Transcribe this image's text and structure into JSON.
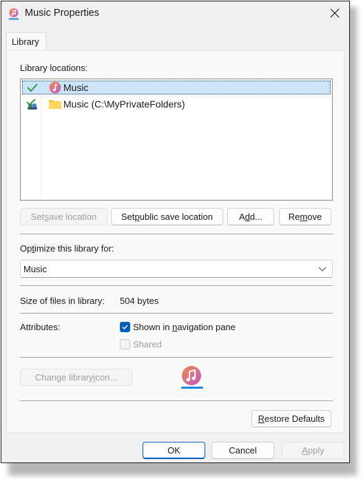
{
  "window": {
    "title": "Music Properties",
    "close_label": "Close"
  },
  "tabs": [
    {
      "label": "Library",
      "active": true
    }
  ],
  "library": {
    "locations_label": "Library locations:",
    "locations": [
      {
        "state_icon": "checkmark-icon",
        "item_icon": "music-library-icon",
        "name": "Music",
        "selected": true
      },
      {
        "state_icon": "shared-checkmark-icon",
        "item_icon": "folder-icon",
        "name": "Music (C:\\MyPrivateFolders)",
        "selected": false
      }
    ],
    "buttons": {
      "set_save_location": {
        "pre": "Set ",
        "key": "s",
        "post": "ave location",
        "enabled": false
      },
      "set_public_save_location": {
        "pre": "Set ",
        "key": "p",
        "post": "ublic save location",
        "enabled": true
      },
      "add": {
        "pre": "A",
        "key": "d",
        "post": "d...",
        "enabled": true
      },
      "remove": {
        "pre": "Re",
        "key": "m",
        "post": "ove",
        "enabled": true
      }
    },
    "optimize_label": {
      "pre": "Op",
      "key": "t",
      "post": "imize this library for:"
    },
    "optimize_value": "Music",
    "size_label": "Size of files in library:",
    "size_value": "504 bytes",
    "attributes_label": "Attributes:",
    "attributes": [
      {
        "pre": "Shown in ",
        "key": "n",
        "post": "avigation pane",
        "checked": true,
        "enabled": true
      },
      {
        "pre": "Shared",
        "key": "",
        "post": "",
        "checked": false,
        "enabled": false
      }
    ],
    "change_icon_button": {
      "pre": "Change library ",
      "key": "i",
      "post": "con...",
      "enabled": false
    },
    "restore_defaults_button": {
      "pre": "",
      "key": "R",
      "post": "estore Defaults"
    }
  },
  "footer": {
    "ok": "OK",
    "cancel": "Cancel",
    "apply": {
      "pre": "",
      "key": "A",
      "post": "pply",
      "enabled": false
    }
  },
  "colors": {
    "accent": "#005fb8",
    "selection": "#cce4f7",
    "music_icon_gradient": [
      "#f08a4b",
      "#c05ac8"
    ],
    "check_green": "#2e9e3e",
    "folder_yellow": "#f5c842"
  }
}
